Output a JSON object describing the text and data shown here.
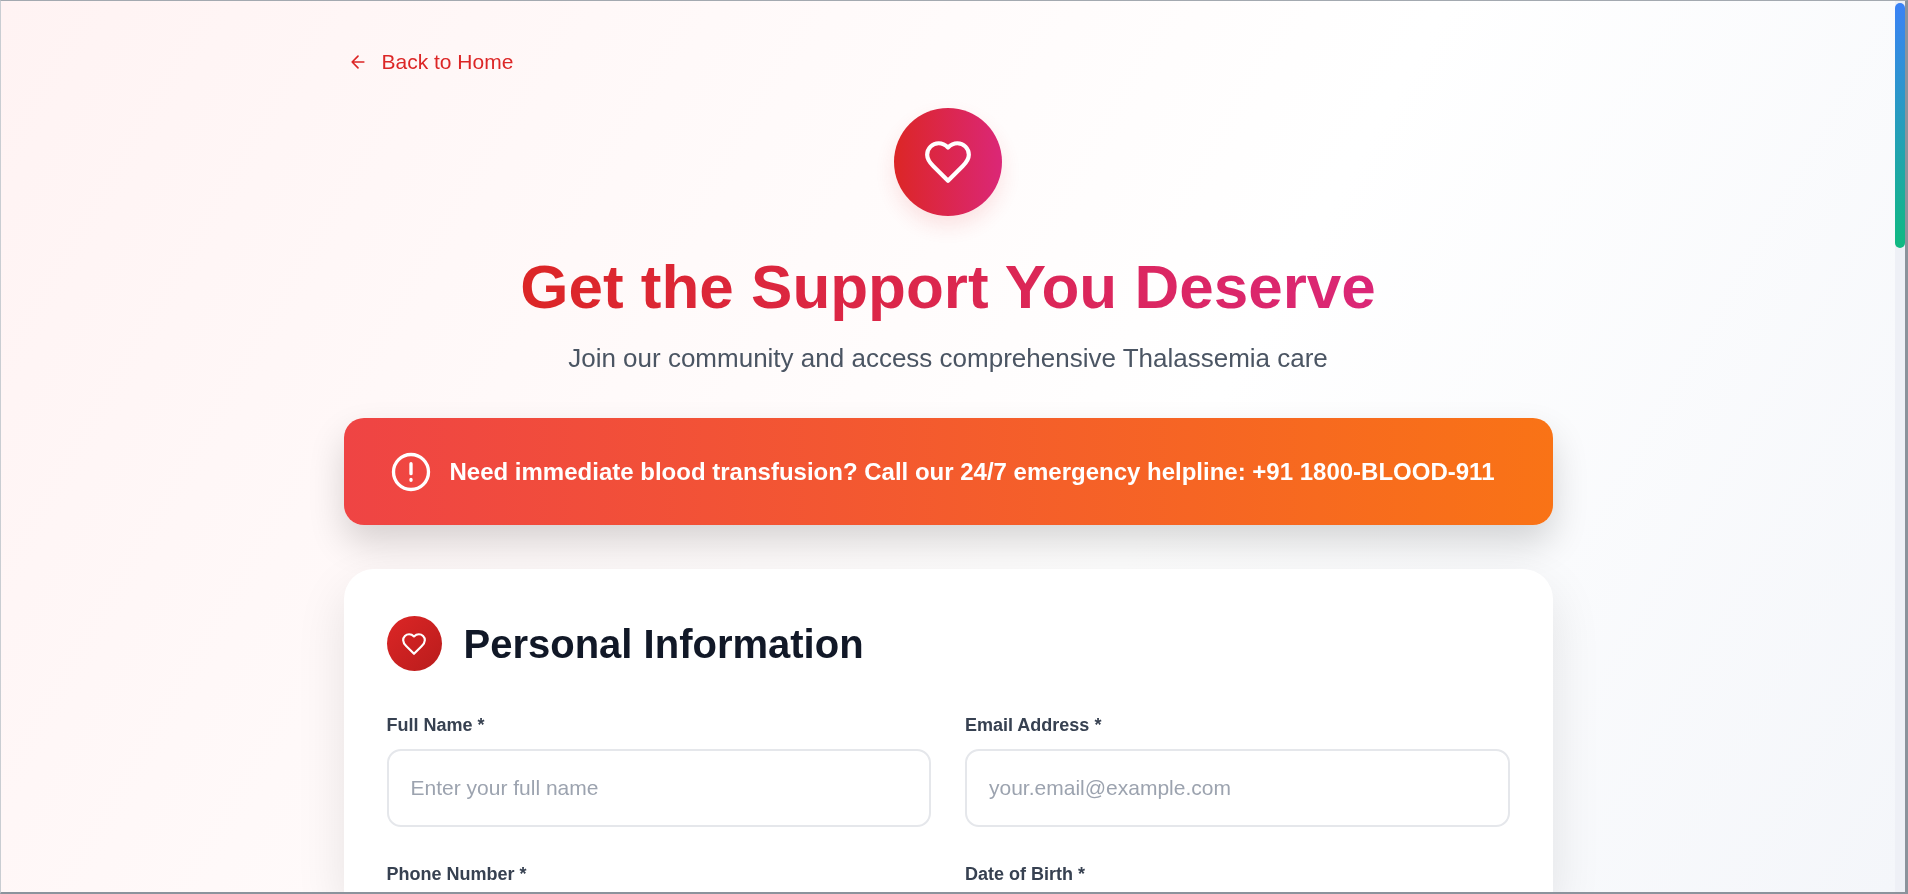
{
  "back_link": {
    "label": "Back to Home"
  },
  "hero": {
    "title": "Get the Support You Deserve",
    "subtitle": "Join our community and access comprehensive Thalassemia care"
  },
  "alert": {
    "message": "Need immediate blood transfusion? Call our 24/7 emergency helpline: +91 1800-BLOOD-911"
  },
  "form": {
    "section_title": "Personal Information",
    "fields": [
      {
        "label": "Full Name *",
        "placeholder": "Enter your full name"
      },
      {
        "label": "Email Address *",
        "placeholder": "your.email@example.com"
      },
      {
        "label": "Phone Number *"
      },
      {
        "label": "Date of Birth *"
      }
    ]
  }
}
